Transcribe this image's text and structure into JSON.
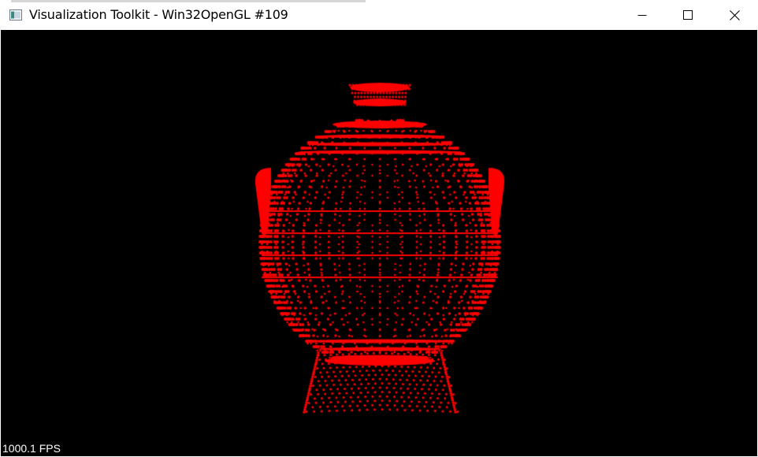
{
  "window": {
    "title": "Visualization Toolkit - Win32OpenGL #109",
    "app_icon": "vtk-window-icon",
    "controls": {
      "minimize": "minimize-icon",
      "maximize": "maximize-icon",
      "close": "close-icon"
    }
  },
  "viewport": {
    "background_color": "#000000",
    "point_color": "#ff0000",
    "fps_text": "1000.1 FPS"
  }
}
